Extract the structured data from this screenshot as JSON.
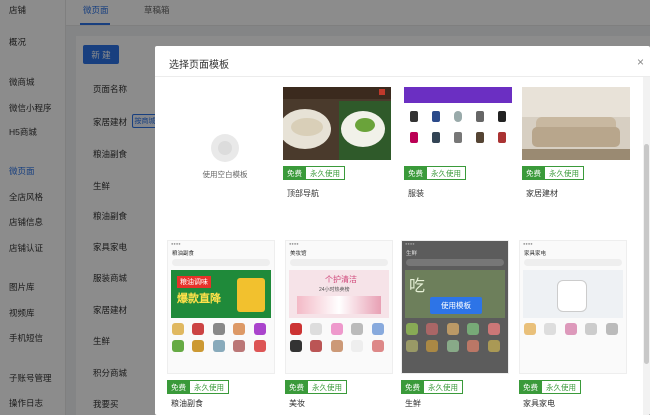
{
  "sidebar": {
    "items": [
      {
        "label": "店铺"
      },
      {
        "label": "概况"
      },
      {
        "label": "微商城"
      },
      {
        "label": "微信小程序"
      },
      {
        "label": "H5商城"
      },
      {
        "label": "微页面"
      },
      {
        "label": "全店风格"
      },
      {
        "label": "店铺信息"
      },
      {
        "label": "店铺认证"
      },
      {
        "label": "图片库"
      },
      {
        "label": "视频库"
      },
      {
        "label": "手机短信"
      },
      {
        "label": "子账号管理"
      },
      {
        "label": "操作日志"
      }
    ]
  },
  "tabs": [
    {
      "label": "微页面"
    },
    {
      "label": "草稿箱"
    }
  ],
  "page": {
    "new_button": "新 建",
    "column_header": "页面名称",
    "badge": "按商城",
    "rows": [
      {
        "name": "家居建材"
      },
      {
        "name": "粮油副食"
      },
      {
        "name": "生鲜"
      },
      {
        "name": "粮油副食"
      },
      {
        "name": "家具家电"
      },
      {
        "name": "服装商城"
      },
      {
        "name": "家居建材"
      },
      {
        "name": "生鲜"
      },
      {
        "name": "积分商城"
      },
      {
        "name": "我要买"
      }
    ]
  },
  "modal": {
    "title": "选择页面模板",
    "close": "×",
    "blank_label": "使用空白模板",
    "use_button": "使用模板",
    "free_label": "免费",
    "perm_label": "永久使用",
    "templates": [
      {
        "name": "顶部导航"
      },
      {
        "name": "服装"
      },
      {
        "name": "家居建材"
      },
      {
        "name": "粮油副食",
        "app_title": "粮油副食",
        "banner_top": "粮油调味",
        "banner_main": "爆款直降"
      },
      {
        "name": "美妆",
        "app_title": "美妆馆",
        "banner_top": "个护清洁",
        "banner_main": "24小时热卖榜"
      },
      {
        "name": "生鲜",
        "app_title": "生鲜",
        "banner_top": "吃",
        "banner_main": ""
      },
      {
        "name": "家具家电",
        "app_title": "家具家电",
        "banner_top": "",
        "banner_main": ""
      }
    ]
  },
  "colors": {
    "accent": "#2d74e7",
    "green": "#3a9a3a",
    "overlay": "rgba(0,0,0,0.45)"
  }
}
